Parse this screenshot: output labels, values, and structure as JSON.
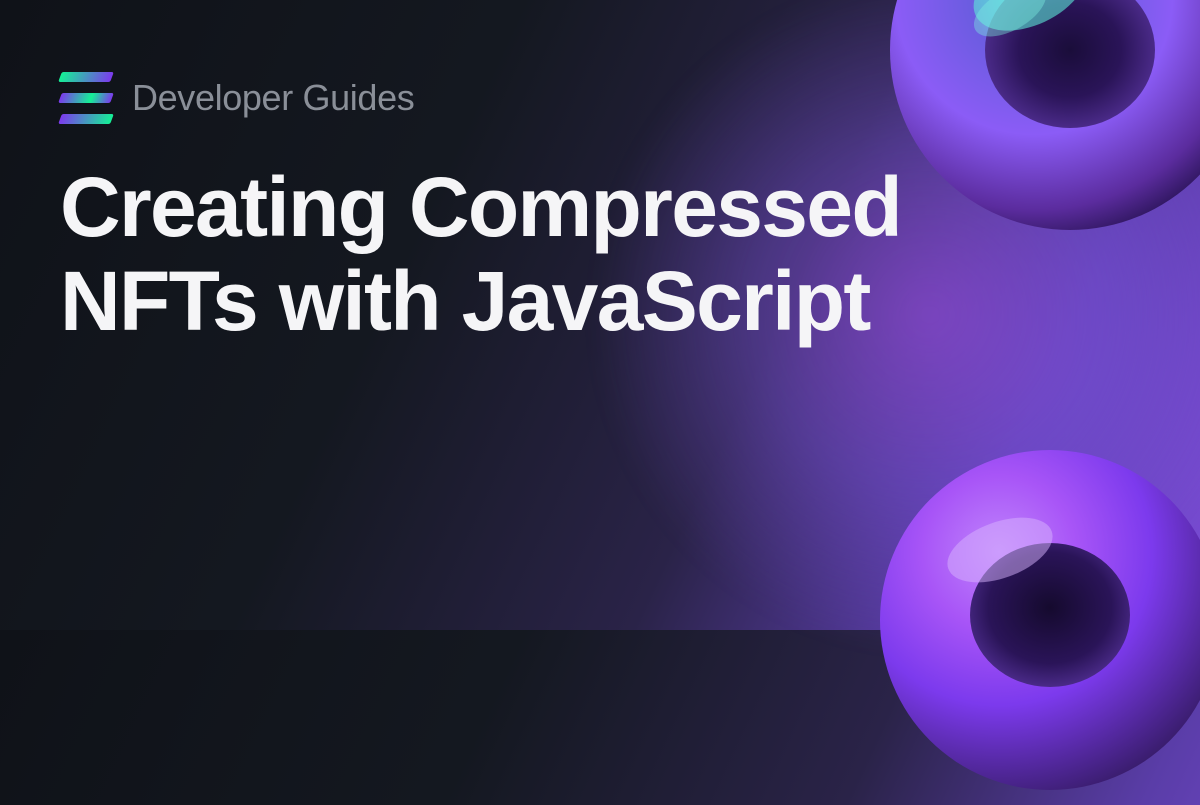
{
  "subtitle": "Developer Guides",
  "title": "Creating Compressed NFTs with JavaScript",
  "logo_name": "solana-logo"
}
